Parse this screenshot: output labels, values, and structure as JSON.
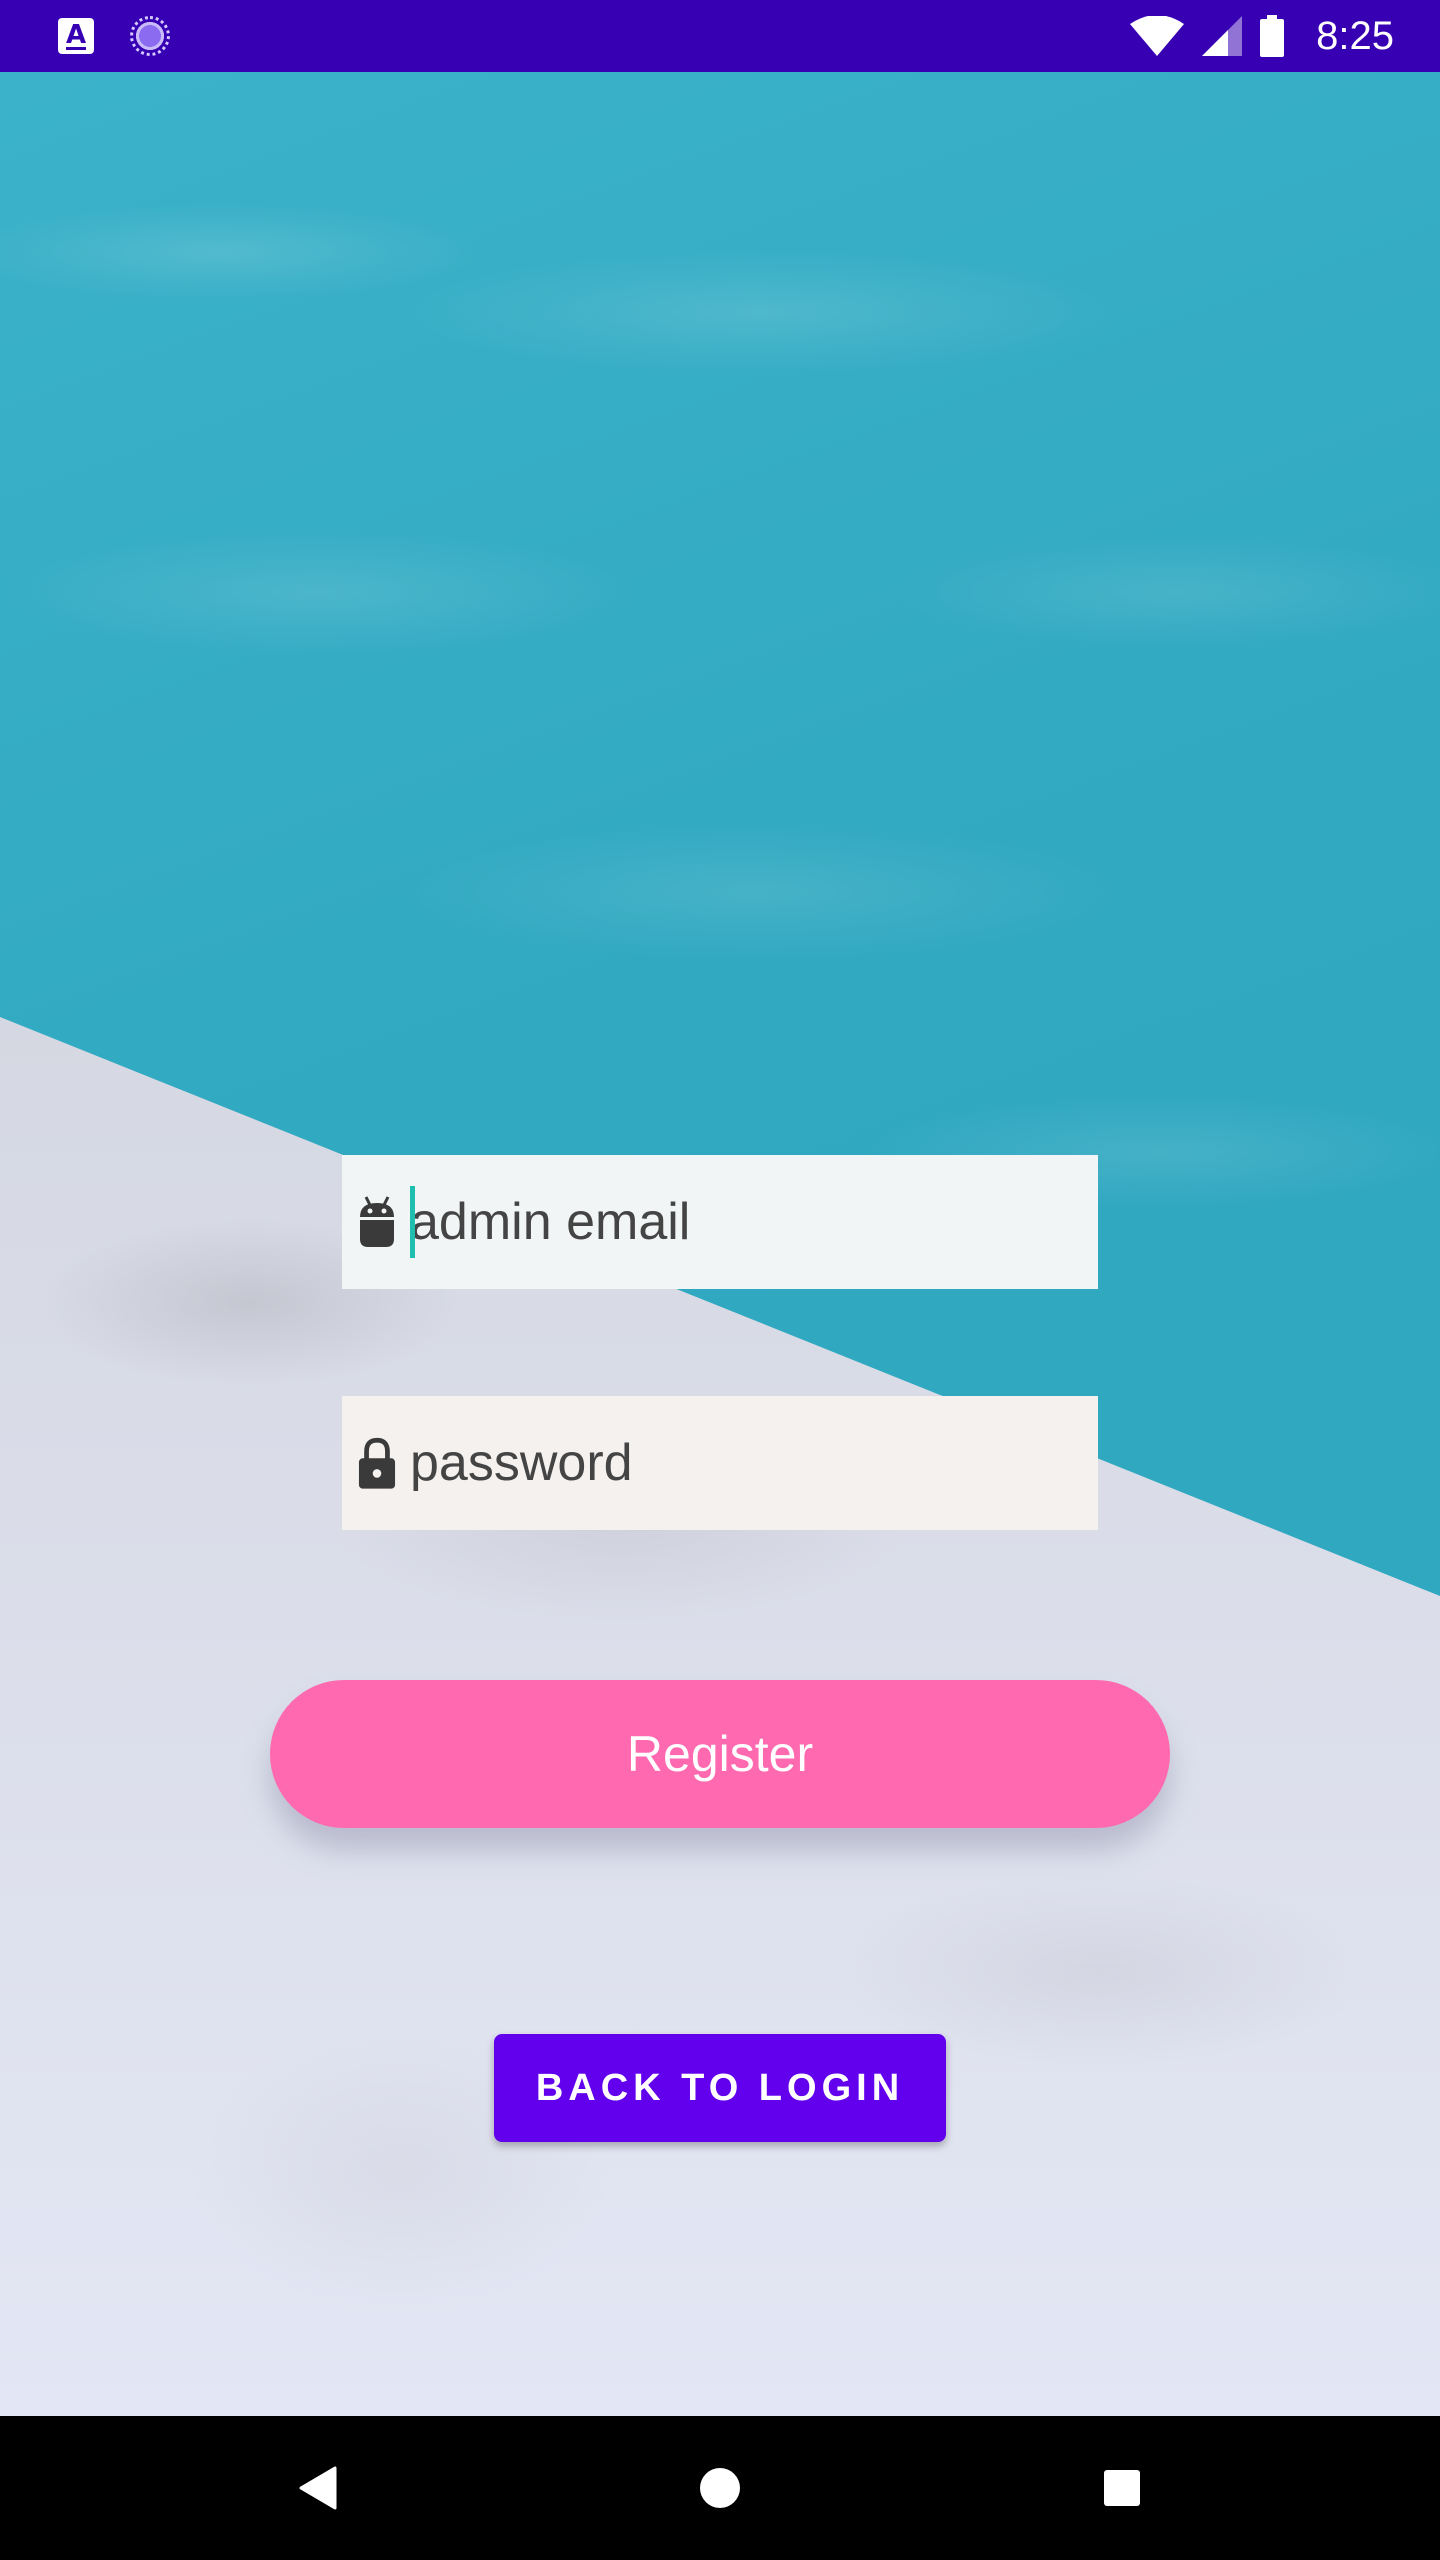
{
  "status_bar": {
    "time": "8:25",
    "app_icon_letter": "A",
    "background_color": "#3700B3"
  },
  "form": {
    "email": {
      "placeholder": "admin email",
      "value": "",
      "icon": "android-icon"
    },
    "password": {
      "placeholder": "password",
      "value": "",
      "icon": "lock-icon"
    }
  },
  "buttons": {
    "register_label": "Register",
    "register_color": "#FF69B0",
    "back_to_login_label": "BACK TO LOGIN",
    "back_to_login_color": "#6200EE"
  },
  "nav_bar": {
    "back": "back-triangle-icon",
    "home": "home-circle-icon",
    "recents": "recents-square-icon"
  }
}
